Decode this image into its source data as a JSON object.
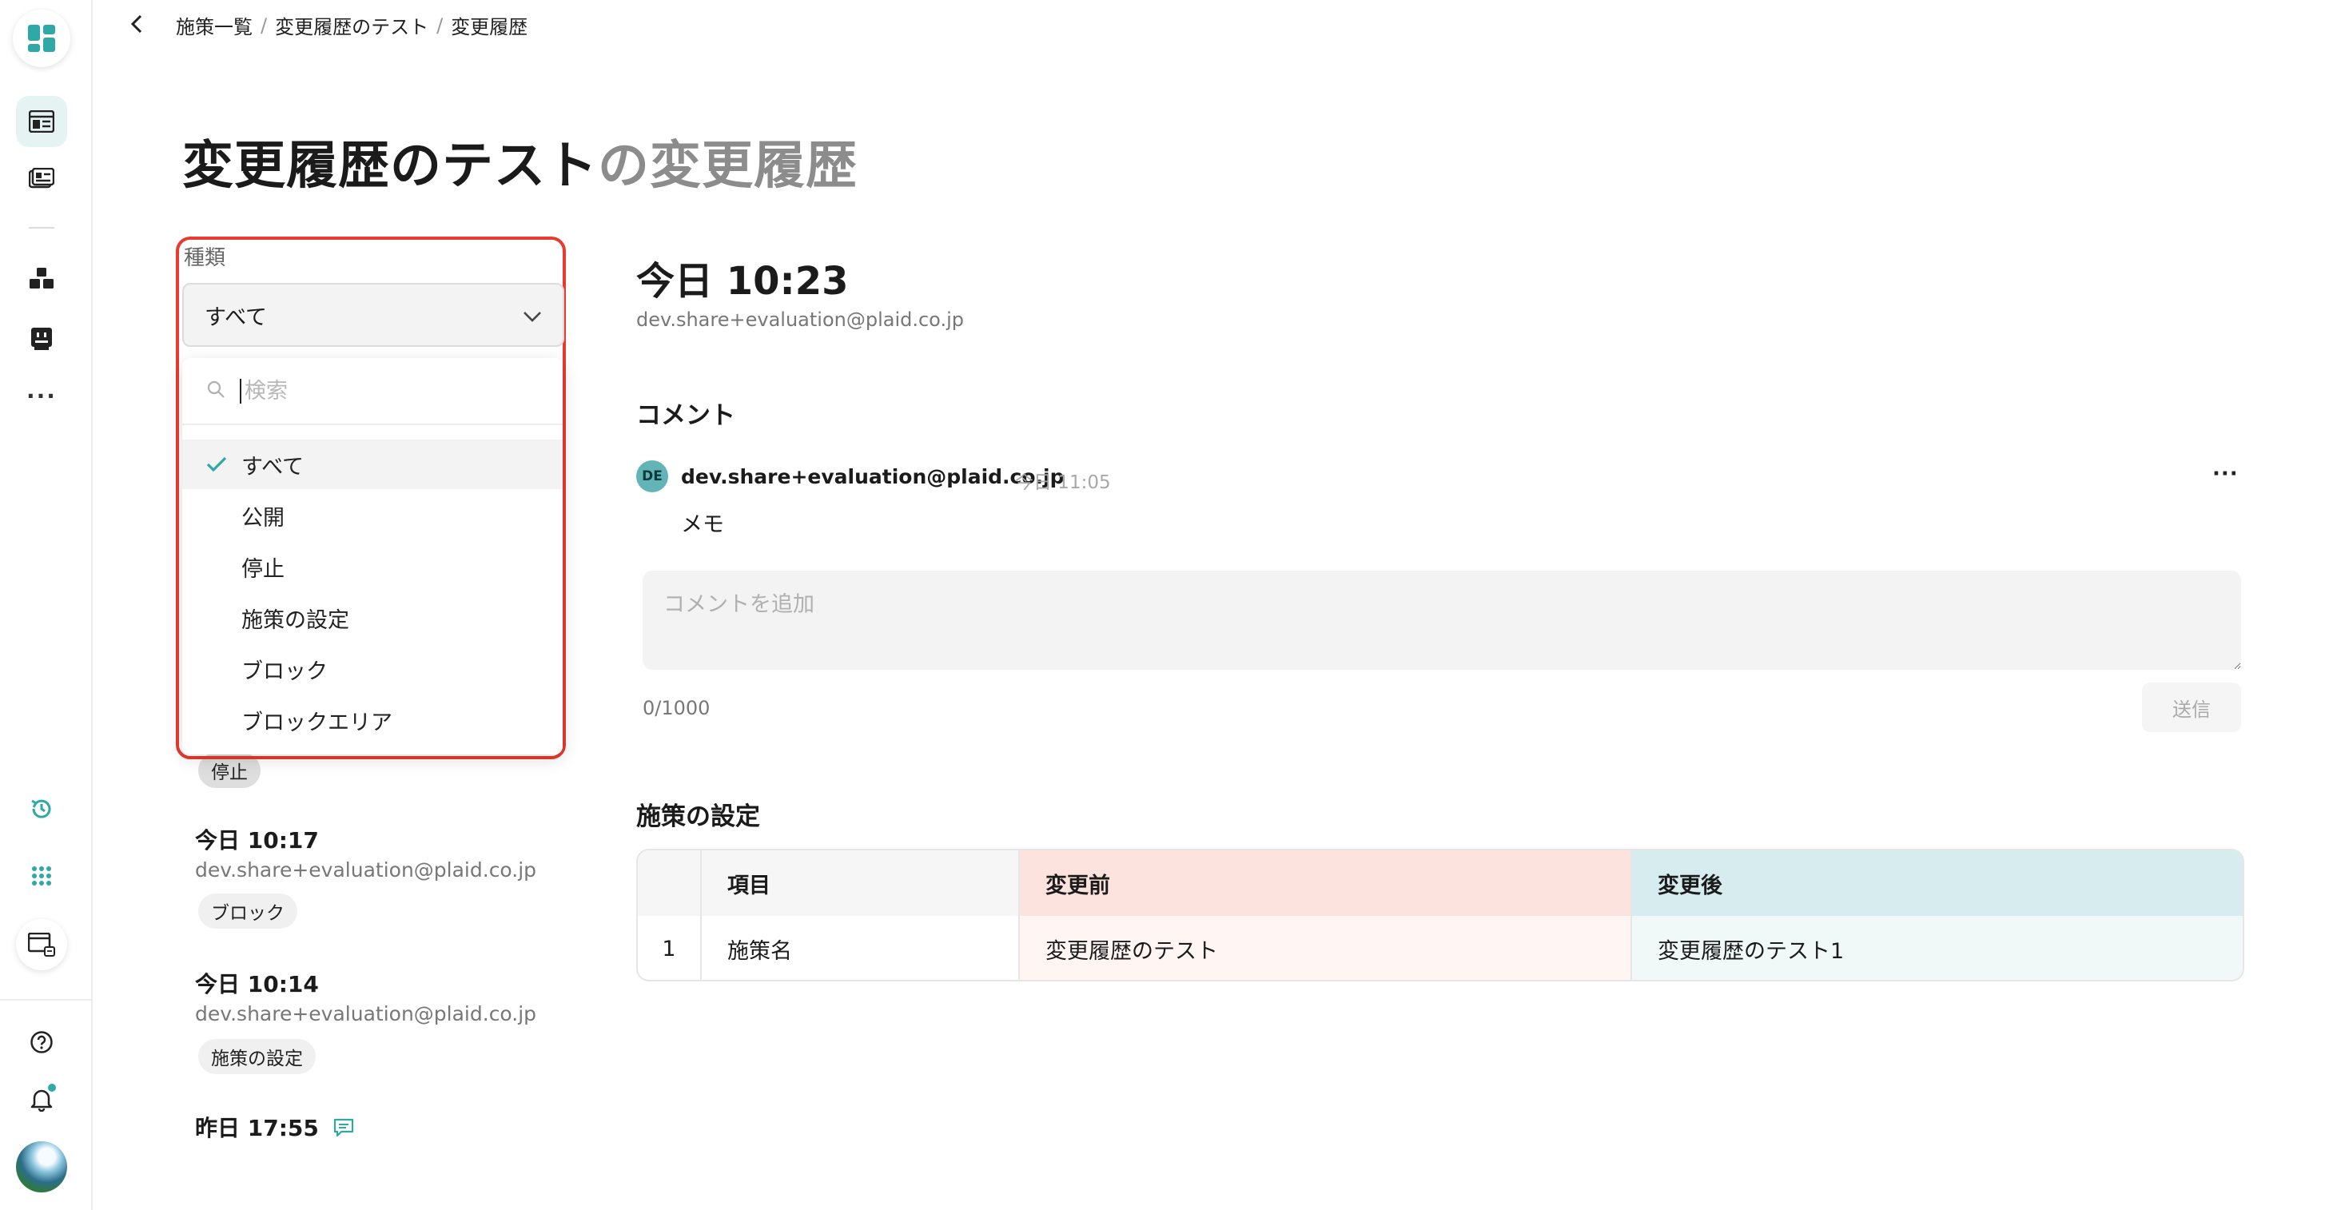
{
  "breadcrumb": {
    "items": [
      "施策一覧",
      "変更履歴のテスト",
      "変更履歴"
    ],
    "sep": "/"
  },
  "page": {
    "title_main": "変更履歴のテスト",
    "title_suffix": "の変更履歴"
  },
  "filter": {
    "label": "種類",
    "selected": "すべて",
    "search_placeholder": "検索",
    "options": [
      "すべて",
      "公開",
      "停止",
      "施策の設定",
      "ブロック",
      "ブロックエリア"
    ]
  },
  "history": [
    {
      "tag": "停止"
    },
    {
      "time": "今日 10:17",
      "email": "dev.share+evaluation@plaid.co.jp",
      "tag": "ブロック"
    },
    {
      "time": "今日 10:14",
      "email": "dev.share+evaluation@plaid.co.jp",
      "tag": "施策の設定"
    },
    {
      "time": "昨日 17:55"
    }
  ],
  "detail": {
    "time": "今日 10:23",
    "email": "dev.share+evaluation@plaid.co.jp",
    "comments_title": "コメント",
    "comment": {
      "avatar_initials": "DE",
      "author": "dev.share+evaluation@plaid.co.jp",
      "time": "今日 11:05",
      "menu": "···",
      "body": "メモ"
    },
    "add_comment_placeholder": "コメントを追加",
    "char_count": "0/1000",
    "send_label": "送信",
    "settings_title": "施策の設定",
    "table": {
      "headers": [
        "",
        "項目",
        "変更前",
        "変更後"
      ],
      "rows": [
        [
          "1",
          "施策名",
          "変更履歴のテスト",
          "変更履歴のテスト1"
        ]
      ]
    }
  },
  "colors": {
    "accent": "#2fa8a8",
    "highlight_border": "#e83a2e",
    "before_header_bg": "#fde3dd",
    "before_cell_bg": "#fff6f3",
    "after_header_bg": "#d6ecef",
    "after_cell_bg": "#f0f8f8"
  },
  "icons": {
    "sidebar": [
      "app-logo-icon",
      "campaign-list-icon",
      "template-icon",
      "blocks-icon",
      "robot-icon",
      "more-icon",
      "history-icon",
      "apps-grid-icon",
      "preview-icon",
      "help-icon",
      "bell-icon"
    ]
  }
}
